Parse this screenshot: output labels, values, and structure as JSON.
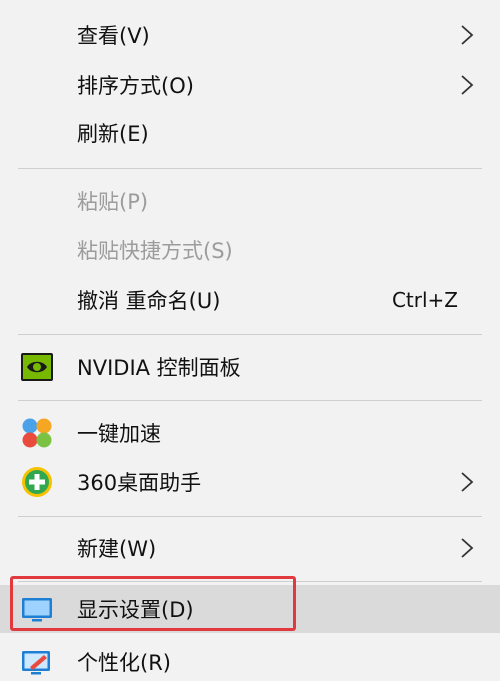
{
  "menu": {
    "items": [
      {
        "label": "查看(V)",
        "submenu": true
      },
      {
        "label": "排序方式(O)",
        "submenu": true
      },
      {
        "label": "刷新(E)"
      },
      {
        "label": "粘贴(P)",
        "disabled": true
      },
      {
        "label": "粘贴快捷方式(S)",
        "disabled": true
      },
      {
        "label": "撤消 重命名(U)",
        "shortcut": "Ctrl+Z"
      },
      {
        "label": "NVIDIA 控制面板",
        "icon": "nvidia-icon"
      },
      {
        "label": "一键加速",
        "icon": "speedup-icon"
      },
      {
        "label": "360桌面助手",
        "icon": "360-desktop-icon",
        "submenu": true
      },
      {
        "label": "新建(W)",
        "submenu": true
      },
      {
        "label": "显示设置(D)",
        "icon": "display-settings-icon",
        "highlighted": true
      },
      {
        "label": "个性化(R)",
        "icon": "personalize-icon"
      }
    ]
  },
  "colors": {
    "menu_background": "#f2f2f2",
    "hover_background": "#dadada",
    "highlight_border": "#e2393f",
    "disabled_text": "#9c9c9c"
  }
}
